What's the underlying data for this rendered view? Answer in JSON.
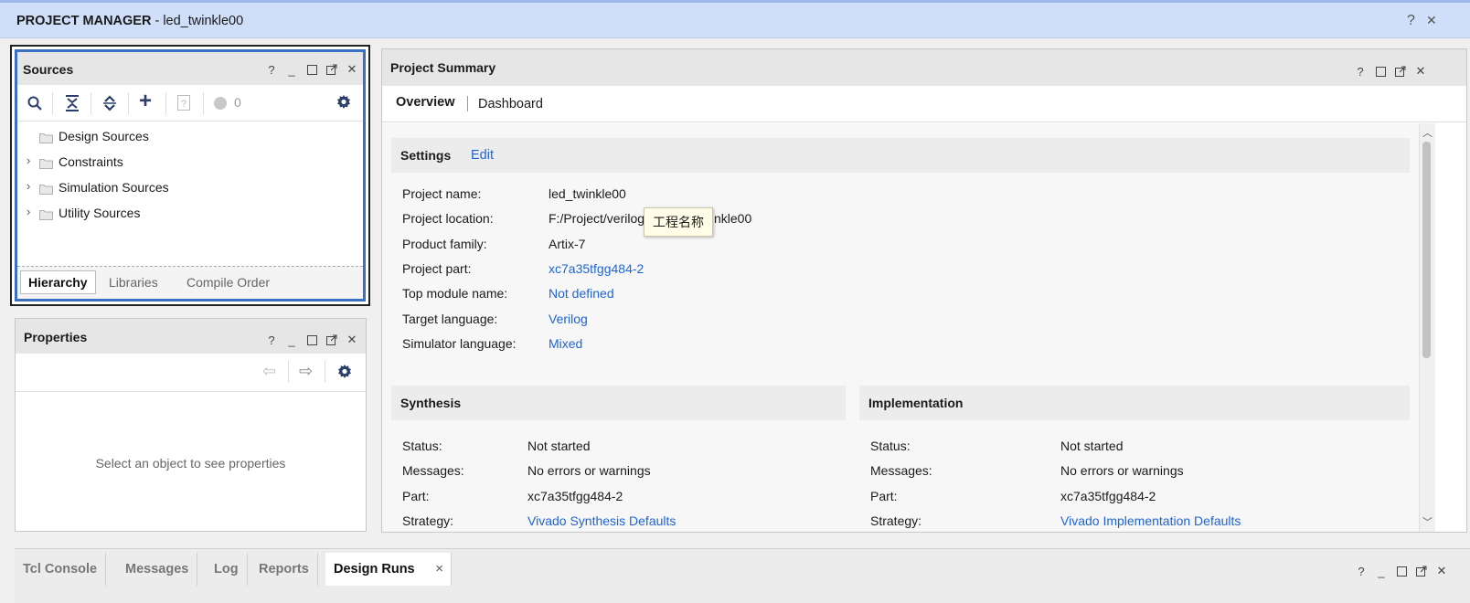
{
  "header": {
    "title": "PROJECT MANAGER",
    "subtitle": " - led_twinkle00",
    "help": "?"
  },
  "sources": {
    "title": "Sources",
    "badge_count": "0",
    "tree": [
      {
        "label": "Design Sources",
        "expandable": false
      },
      {
        "label": "Constraints",
        "expandable": true
      },
      {
        "label": "Simulation Sources",
        "expandable": true
      },
      {
        "label": "Utility Sources",
        "expandable": true
      }
    ],
    "tabs": [
      "Hierarchy",
      "Libraries",
      "Compile Order"
    ]
  },
  "properties": {
    "title": "Properties",
    "empty_message": "Select an object to see properties"
  },
  "summary": {
    "title": "Project Summary",
    "tabs": [
      "Overview",
      "Dashboard"
    ],
    "settings": {
      "heading": "Settings",
      "edit": "Edit",
      "rows": [
        {
          "label": "Project name:",
          "value": "led_twinkle00",
          "link": false
        },
        {
          "label": "Project location:",
          "value": "F:/Project/verilog",
          "value_tail": "nkle00",
          "link": false
        },
        {
          "label": "Product family:",
          "value": "Artix-7",
          "link": false
        },
        {
          "label": "Project part:",
          "value": "xc7a35tfgg484-2",
          "link": true
        },
        {
          "label": "Top module name:",
          "value": "Not defined",
          "link": true
        },
        {
          "label": "Target language:",
          "value": "Verilog",
          "link": true
        },
        {
          "label": "Simulator language:",
          "value": "Mixed",
          "link": true
        }
      ]
    },
    "tooltip": "工程名称",
    "synthesis": {
      "heading": "Synthesis",
      "rows": [
        {
          "label": "Status:",
          "value": "Not started",
          "link": false
        },
        {
          "label": "Messages:",
          "value": "No errors or warnings",
          "link": false
        },
        {
          "label": "Part:",
          "value": "xc7a35tfgg484-2",
          "link": false
        },
        {
          "label": "Strategy:",
          "value": "Vivado Synthesis Defaults",
          "link": true
        }
      ]
    },
    "implementation": {
      "heading": "Implementation",
      "rows": [
        {
          "label": "Status:",
          "value": "Not started",
          "link": false
        },
        {
          "label": "Messages:",
          "value": "No errors or warnings",
          "link": false
        },
        {
          "label": "Part:",
          "value": "xc7a35tfgg484-2",
          "link": false
        },
        {
          "label": "Strategy:",
          "value": "Vivado Implementation Defaults",
          "link": true
        }
      ]
    }
  },
  "console": {
    "tabs": [
      "Tcl Console",
      "Messages",
      "Log",
      "Reports",
      "Design Runs"
    ],
    "active": "Design Runs",
    "close": "×"
  },
  "colors": {
    "accent": "#1f64d3",
    "header_bg": "#cfdff9",
    "focus_border": "#3a6fc4"
  },
  "window_controls": {
    "help": "?",
    "minimize": "_",
    "close": "✕"
  }
}
